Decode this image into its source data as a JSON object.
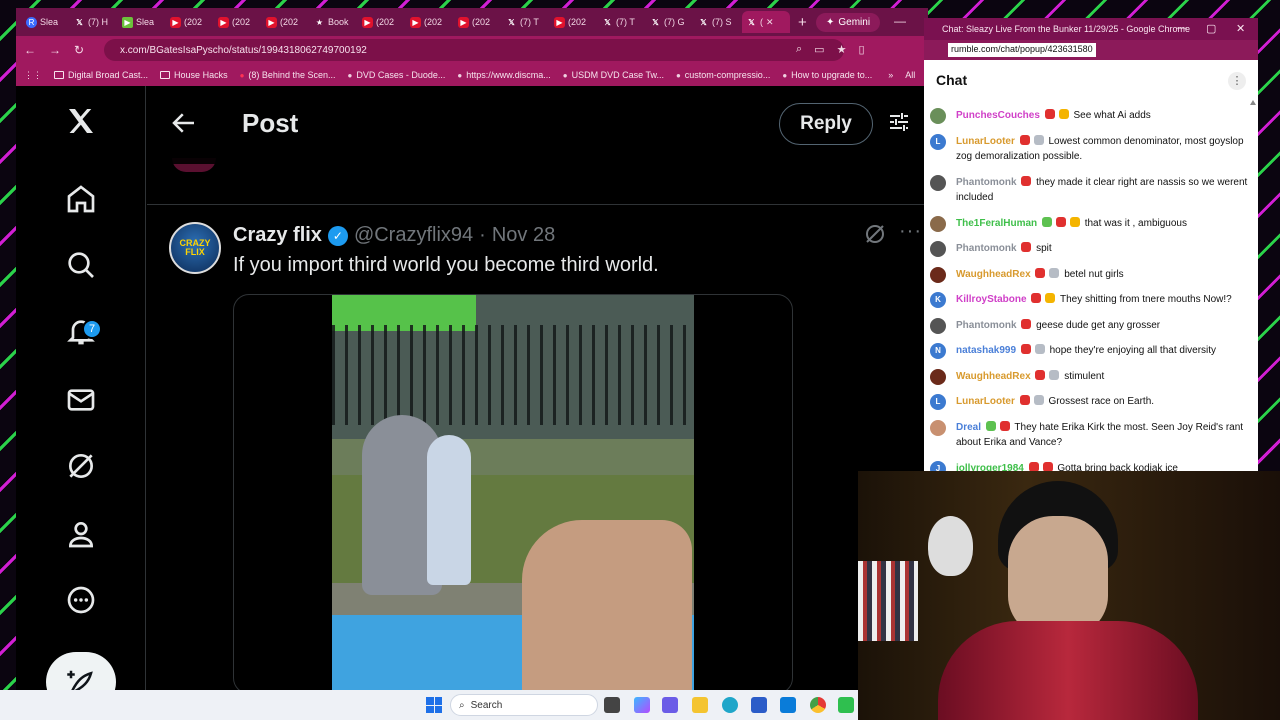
{
  "browser": {
    "tabs": [
      {
        "icon": "R",
        "label": "Slea"
      },
      {
        "icon": "𝕏",
        "label": "(7) H"
      },
      {
        "icon": "▶",
        "label": "Slea"
      },
      {
        "icon": "▶",
        "label": "(202"
      },
      {
        "icon": "▶",
        "label": "(202"
      },
      {
        "icon": "▶",
        "label": "(202"
      },
      {
        "icon": "★",
        "label": "Book"
      },
      {
        "icon": "▶",
        "label": "(202"
      },
      {
        "icon": "▶",
        "label": "(202"
      },
      {
        "icon": "▶",
        "label": "(202"
      },
      {
        "icon": "𝕏",
        "label": "(7) T"
      },
      {
        "icon": "▶",
        "label": "(202"
      },
      {
        "icon": "𝕏",
        "label": "(7) T"
      },
      {
        "icon": "𝕏",
        "label": "(7) G"
      },
      {
        "icon": "𝕏",
        "label": "(7) S"
      },
      {
        "icon": "𝕏",
        "label": "("
      }
    ],
    "active_tab_close": "✕",
    "new_tab": "+",
    "gemini_label": "Gemini",
    "minimize": "—",
    "url": "x.com/BGatesIsaPyscho/status/1994318062749700192",
    "bookmarks": [
      {
        "icon": "folder-icon",
        "label": "Digital Broad Cast..."
      },
      {
        "icon": "folder-icon",
        "label": "House Hacks"
      },
      {
        "icon": "youtube-icon",
        "label": "(8) Behind the Scen..."
      },
      {
        "icon": "dvd-icon",
        "label": "DVD Cases - Duode..."
      },
      {
        "icon": "web-icon",
        "label": "https://www.discma..."
      },
      {
        "icon": "web-icon",
        "label": "USDM DVD Case Tw..."
      },
      {
        "icon": "image-icon",
        "label": "custom-compressio..."
      },
      {
        "icon": "apple-icon",
        "label": "How to upgrade to..."
      }
    ],
    "bookmarks_overflow": "»",
    "bookmarks_all": "All"
  },
  "x": {
    "notifications_count": "7",
    "header_title": "Post",
    "reply_label": "Reply",
    "tweet": {
      "avatar_text": "CRAZY FLIX",
      "name": "Crazy flix",
      "handle": "@Crazyflix94",
      "separator": "·",
      "date": "Nov 28",
      "more": "···",
      "text": "If you import third world you become third world."
    }
  },
  "chat": {
    "window_title": "Chat: Sleazy Live From the Bunker 11/29/25 - Google Chrome",
    "url": "rumble.com/chat/popup/423631580",
    "heading": "Chat",
    "menu": "⋮",
    "messages": [
      {
        "initial": "",
        "av_color": "#6a8f5a",
        "user": "PunchesCouches",
        "user_color": "#d040c8",
        "badges": [
          "red",
          "gold"
        ],
        "text": "See what Ai adds"
      },
      {
        "initial": "L",
        "av_color": "#3c7ad0",
        "user": "LunarLooter",
        "user_color": "#d89a2e",
        "badges": [
          "red",
          "grey"
        ],
        "text": "Lowest common denominator, most goyslop zog demoralization possible."
      },
      {
        "initial": "",
        "av_color": "#555",
        "user": "Phantomonk",
        "user_color": "#8a8f98",
        "badges": [
          "red"
        ],
        "text": "they made it clear right are nassis so we werent included"
      },
      {
        "initial": "",
        "av_color": "#8a6a4a",
        "user": "The1FeralHuman",
        "user_color": "#3fbf4a",
        "badges": [
          "green",
          "red",
          "gold"
        ],
        "text": "that was it , ambiguous"
      },
      {
        "initial": "",
        "av_color": "#555",
        "user": "Phantomonk",
        "user_color": "#8a8f98",
        "badges": [
          "red"
        ],
        "text": "spit"
      },
      {
        "initial": "",
        "av_color": "#6b2a1a",
        "user": "WaughheadRex",
        "user_color": "#d89a2e",
        "badges": [
          "red",
          "grey"
        ],
        "text": "betel nut girls"
      },
      {
        "initial": "K",
        "av_color": "#3c7ad0",
        "user": "KillroyStabone",
        "user_color": "#d040c8",
        "badges": [
          "red",
          "gold"
        ],
        "text": "They shitting from tnere mouths Now!?"
      },
      {
        "initial": "",
        "av_color": "#555",
        "user": "Phantomonk",
        "user_color": "#8a8f98",
        "badges": [
          "red"
        ],
        "text": "geese dude get any grosser"
      },
      {
        "initial": "N",
        "av_color": "#3c7ad0",
        "user": "natashak999",
        "user_color": "#4a7fd8",
        "badges": [
          "red",
          "grey"
        ],
        "text": "hope they're enjoying all that diversity"
      },
      {
        "initial": "",
        "av_color": "#6b2a1a",
        "user": "WaughheadRex",
        "user_color": "#d89a2e",
        "badges": [
          "red",
          "grey"
        ],
        "text": "stimulent"
      },
      {
        "initial": "L",
        "av_color": "#3c7ad0",
        "user": "LunarLooter",
        "user_color": "#d89a2e",
        "badges": [
          "red",
          "grey"
        ],
        "text": "Grossest race on Earth."
      },
      {
        "initial": "",
        "av_color": "#c89070",
        "user": "Dreal",
        "user_color": "#4a7fd8",
        "badges": [
          "green",
          "red"
        ],
        "text": "They hate Erika Kirk the most. Seen Joy Reid's rant about Erika and Vance?"
      },
      {
        "initial": "J",
        "av_color": "#3c7ad0",
        "user": "jollyroger1984",
        "user_color": "#3fbf4a",
        "badges": [
          "red",
          "red"
        ],
        "text": "Gotta bring back kodiak ice"
      }
    ]
  },
  "taskbar": {
    "search_label": "Search"
  },
  "colors": {
    "accent": "#a0195f",
    "x_blue": "#1d9bf0"
  }
}
